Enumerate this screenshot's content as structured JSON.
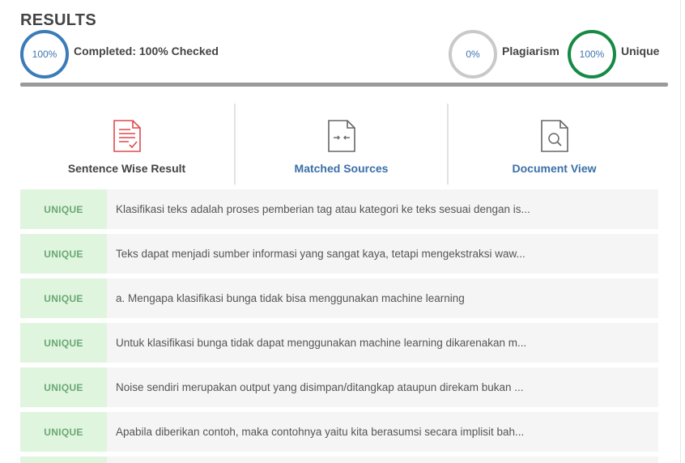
{
  "header": {
    "title": "RESULTS"
  },
  "summary": {
    "completed_ring": "100%",
    "completed_label": "Completed: 100% Checked",
    "plagiarism_ring": "0%",
    "plagiarism_label": "Plagiarism",
    "unique_ring": "100%",
    "unique_label": "Unique",
    "progress_fraction": 1.0,
    "colors": {
      "completed": "#3b7cb8",
      "plagiarism": "#c9c9c9",
      "unique": "#168a45"
    }
  },
  "tabs": [
    {
      "label": "Sentence Wise Result",
      "icon": "document-check-icon"
    },
    {
      "label": "Matched Sources",
      "icon": "document-compare-icon"
    },
    {
      "label": "Document View",
      "icon": "document-search-icon"
    }
  ],
  "rows": [
    {
      "tag": "UNIQUE",
      "text": "Klasifikasi teks adalah proses pemberian tag atau kategori ke teks sesuai dengan is..."
    },
    {
      "tag": "UNIQUE",
      "text": "Teks dapat menjadi sumber informasi yang sangat kaya, tetapi mengekstraksi waw..."
    },
    {
      "tag": "UNIQUE",
      "text": "a. Mengapa klasifikasi bunga tidak bisa menggunakan machine learning"
    },
    {
      "tag": "UNIQUE",
      "text": "Untuk klasifikasi bunga tidak dapat menggunakan machine learning dikarenakan m..."
    },
    {
      "tag": "UNIQUE",
      "text": "Noise sendiri merupakan output yang disimpan/ditangkap ataupun direkam bukan ..."
    },
    {
      "tag": "UNIQUE",
      "text": "Apabila diberikan contoh, maka contohnya yaitu kita berasumsi secara implisit bah..."
    }
  ]
}
